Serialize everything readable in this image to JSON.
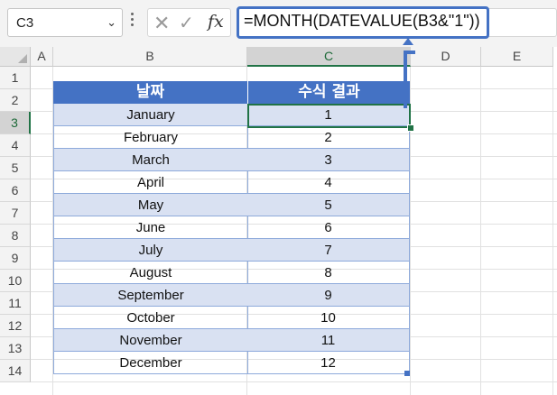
{
  "namebox": {
    "value": "C3"
  },
  "formula_bar": {
    "cancel_icon": "x-icon",
    "enter_icon": "check-icon",
    "fx_label": "fx",
    "formula": "=MONTH(DATEVALUE(B3&\"1\"))"
  },
  "columns": [
    "A",
    "B",
    "C",
    "D",
    "E"
  ],
  "rows": [
    "1",
    "2",
    "3",
    "4",
    "5",
    "6",
    "7",
    "8",
    "9",
    "10",
    "11",
    "12",
    "13",
    "14"
  ],
  "active": {
    "column": "C",
    "row": "3"
  },
  "table": {
    "headers": [
      "날짜",
      "수식 결과"
    ],
    "rows": [
      [
        "January",
        "1"
      ],
      [
        "February",
        "2"
      ],
      [
        "March",
        "3"
      ],
      [
        "April",
        "4"
      ],
      [
        "May",
        "5"
      ],
      [
        "June",
        "6"
      ],
      [
        "July",
        "7"
      ],
      [
        "August",
        "8"
      ],
      [
        "September",
        "9"
      ],
      [
        "October",
        "10"
      ],
      [
        "November",
        "11"
      ],
      [
        "December",
        "12"
      ]
    ]
  },
  "colors": {
    "header": "#4472c4",
    "band": "#d9e1f2",
    "accent": "#217346"
  }
}
